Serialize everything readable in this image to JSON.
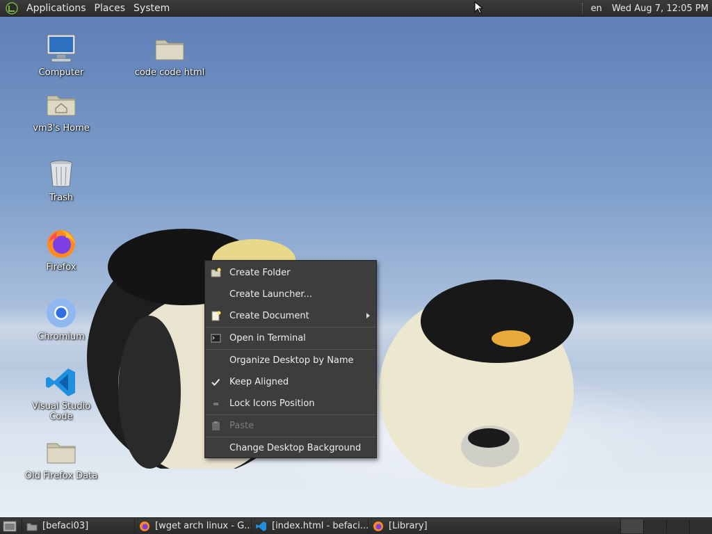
{
  "top_panel": {
    "menus": [
      "Applications",
      "Places",
      "System"
    ],
    "language": "en",
    "clock": "Wed Aug  7, 12:05 PM"
  },
  "desktop_icons": [
    {
      "label": "Computer",
      "icon": "computer-icon"
    },
    {
      "label": "code code html",
      "icon": "folder-icon"
    },
    {
      "label": "vm3's Home",
      "icon": "home-folder-icon"
    },
    {
      "label": "Trash",
      "icon": "trash-icon"
    },
    {
      "label": "Firefox",
      "icon": "firefox-icon"
    },
    {
      "label": "Chromium",
      "icon": "chromium-icon"
    },
    {
      "label": "Visual Studio Code",
      "icon": "vscode-icon"
    },
    {
      "label": "Old Firefox Data",
      "icon": "folder-icon"
    }
  ],
  "context_menu": {
    "items": [
      {
        "label": "Create Folder",
        "icon": "create-folder-icon",
        "disabled": false
      },
      {
        "label": "Create Launcher...",
        "icon": "",
        "disabled": false
      },
      {
        "label": "Create Document",
        "icon": "create-document-icon",
        "disabled": false,
        "submenu": true
      },
      {
        "label": "Open in Terminal",
        "icon": "terminal-icon",
        "disabled": false
      },
      {
        "label": "Organize Desktop by Name",
        "icon": "",
        "disabled": false
      },
      {
        "label": "Keep Aligned",
        "icon": "checkmark-icon",
        "disabled": false,
        "checked": true
      },
      {
        "label": "Lock Icons Position",
        "icon": "unchecked-icon",
        "disabled": false
      },
      {
        "label": "Paste",
        "icon": "paste-icon",
        "disabled": true
      },
      {
        "label": "Change Desktop Background",
        "icon": "",
        "disabled": false
      }
    ]
  },
  "taskbar": {
    "tasks": [
      {
        "label": "[befaci03]",
        "icon": "folder-icon"
      },
      {
        "label": "[wget arch linux - G...",
        "icon": "firefox-icon"
      },
      {
        "label": "[index.html - befaci...",
        "icon": "vscode-icon"
      },
      {
        "label": "[Library]",
        "icon": "firefox-icon"
      }
    ]
  },
  "colors": {
    "panel": "#2e2e2e",
    "menu_bg": "#3d3d3d",
    "menu_text": "#eeeeee",
    "disabled_text": "#7d7d7d"
  }
}
